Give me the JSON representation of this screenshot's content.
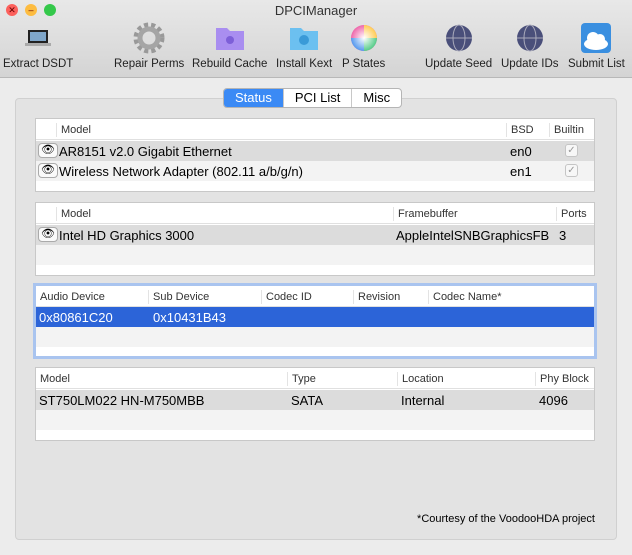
{
  "window": {
    "title": "DPCIManager"
  },
  "toolbar": [
    {
      "label": "Extract DSDT",
      "icon": "laptop-icon"
    },
    {
      "label": "Repair Perms",
      "icon": "gear-icon"
    },
    {
      "label": "Rebuild Cache",
      "icon": "purple-folder-icon"
    },
    {
      "label": "Install Kext",
      "icon": "blue-folder-icon"
    },
    {
      "label": "P States",
      "icon": "color-wheel-icon"
    },
    {
      "label": "Update Seed",
      "icon": "globe-icon"
    },
    {
      "label": "Update IDs",
      "icon": "globe-icon"
    },
    {
      "label": "Submit List",
      "icon": "cloud-icon"
    }
  ],
  "tabs": [
    "Status",
    "PCI List",
    "Misc"
  ],
  "network": {
    "headers": [
      "Model",
      "BSD",
      "Builtin"
    ],
    "rows": [
      {
        "model": "AR8151 v2.0 Gigabit Ethernet",
        "bsd": "en0",
        "builtin": true
      },
      {
        "model": "Wireless Network Adapter (802.11 a/b/g/n)",
        "bsd": "en1",
        "builtin": true
      }
    ]
  },
  "graphics": {
    "headers": [
      "Model",
      "Framebuffer",
      "Ports"
    ],
    "rows": [
      {
        "model": "Intel HD Graphics 3000",
        "framebuffer": "AppleIntelSNBGraphicsFB",
        "ports": "3"
      }
    ]
  },
  "audio": {
    "headers": [
      "Audio Device",
      "Sub Device",
      "Codec ID",
      "Revision",
      "Codec Name*"
    ],
    "rows": [
      {
        "device": "0x80861C20",
        "sub": "0x10431B43",
        "codec": "",
        "revision": "",
        "name": ""
      }
    ]
  },
  "storage": {
    "headers": [
      "Model",
      "Type",
      "Location",
      "Phy Block"
    ],
    "rows": [
      {
        "model": "ST750LM022 HN-M750MBB",
        "type": "SATA",
        "location": "Internal",
        "block": "4096"
      }
    ]
  },
  "footer": "*Courtesy of the VoodooHDA project"
}
